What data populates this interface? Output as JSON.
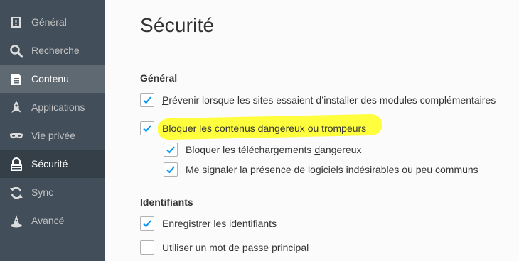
{
  "sidebar": {
    "items": [
      {
        "label": "Général",
        "icon": "general-icon"
      },
      {
        "label": "Recherche",
        "icon": "search-icon"
      },
      {
        "label": "Contenu",
        "icon": "content-icon"
      },
      {
        "label": "Applications",
        "icon": "applications-icon"
      },
      {
        "label": "Vie privée",
        "icon": "privacy-mask-icon"
      },
      {
        "label": "Sécurité",
        "icon": "security-lock-icon"
      },
      {
        "label": "Sync",
        "icon": "sync-icon"
      },
      {
        "label": "Avancé",
        "icon": "advanced-wizard-icon"
      }
    ],
    "selected": "Sécurité",
    "hovered": "Contenu"
  },
  "page": {
    "title": "Sécurité",
    "general": {
      "heading": "Général",
      "warn_addons": {
        "label_mn": "P",
        "label_rest": "révenir lorsque les sites essaient d’installer des modules complémentaires",
        "checked": true
      },
      "block_dangerous": {
        "label_mn": "B",
        "label_rest": "loquer les contenus dangereux ou trompeurs",
        "checked": true
      },
      "block_downloads": {
        "label_pre": "Bloquer les téléchargements ",
        "label_mn": "d",
        "label_rest": "angereux",
        "checked": true
      },
      "warn_unwanted": {
        "label_mn": "M",
        "label_rest": "e signaler la présence de logiciels indésirables ou peu communs",
        "checked": true
      }
    },
    "logins": {
      "heading": "Identifiants",
      "remember": {
        "label_pre": "Enregi",
        "label_mn": "s",
        "label_rest": "trer les identifiants",
        "checked": true
      },
      "master_password": {
        "label_mn": "U",
        "label_rest": "tiliser un mot de passe principal",
        "checked": false
      }
    }
  },
  "colors": {
    "sidebar_bg": "#424f5a",
    "sidebar_selected": "#343f48",
    "sidebar_hover": "#5e6972",
    "check_blue": "#0996f8",
    "highlight": "#ffff33"
  }
}
